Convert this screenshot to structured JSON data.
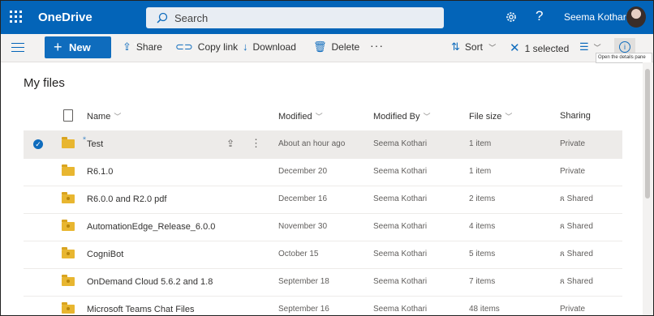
{
  "suitebar": {
    "app_name": "OneDrive",
    "search_placeholder": "Search",
    "help_label": "?",
    "user_name": "Seema Kothari",
    "colors": {
      "brand": "#0364b8",
      "accent": "#0f6cbd"
    }
  },
  "commands": {
    "new_label": "New",
    "share_label": "Share",
    "copy_link_label": "Copy link",
    "download_label": "Download",
    "delete_label": "Delete",
    "more_label": "···",
    "sort_label": "Sort",
    "selected_label": "1 selected",
    "details_tooltip": "Open the details pane"
  },
  "page": {
    "title": "My files"
  },
  "columns": {
    "name": "Name",
    "modified": "Modified",
    "modified_by": "Modified By",
    "file_size": "File size",
    "sharing": "Sharing"
  },
  "rows": [
    {
      "name": "Test",
      "modified": "About an hour ago",
      "modified_by": "Seema Kothari",
      "size": "1 item",
      "sharing": "Private",
      "selected": true,
      "shared": false
    },
    {
      "name": "R6.1.0",
      "modified": "December 20",
      "modified_by": "Seema Kothari",
      "size": "1 item",
      "sharing": "Private",
      "selected": false,
      "shared": false
    },
    {
      "name": "R6.0.0 and R2.0 pdf",
      "modified": "December 16",
      "modified_by": "Seema Kothari",
      "size": "2 items",
      "sharing": "Shared",
      "selected": false,
      "shared": true
    },
    {
      "name": "AutomationEdge_Release_6.0.0",
      "modified": "November 30",
      "modified_by": "Seema Kothari",
      "size": "4 items",
      "sharing": "Shared",
      "selected": false,
      "shared": true
    },
    {
      "name": "CogniBot",
      "modified": "October 15",
      "modified_by": "Seema Kothari",
      "size": "5 items",
      "sharing": "Shared",
      "selected": false,
      "shared": true
    },
    {
      "name": "OnDemand Cloud 5.6.2 and 1.8",
      "modified": "September 18",
      "modified_by": "Seema Kothari",
      "size": "7 items",
      "sharing": "Shared",
      "selected": false,
      "shared": true
    },
    {
      "name": "Microsoft Teams Chat Files",
      "modified": "September 16",
      "modified_by": "Seema Kothari",
      "size": "48 items",
      "sharing": "Private",
      "selected": false,
      "shared": true
    }
  ]
}
